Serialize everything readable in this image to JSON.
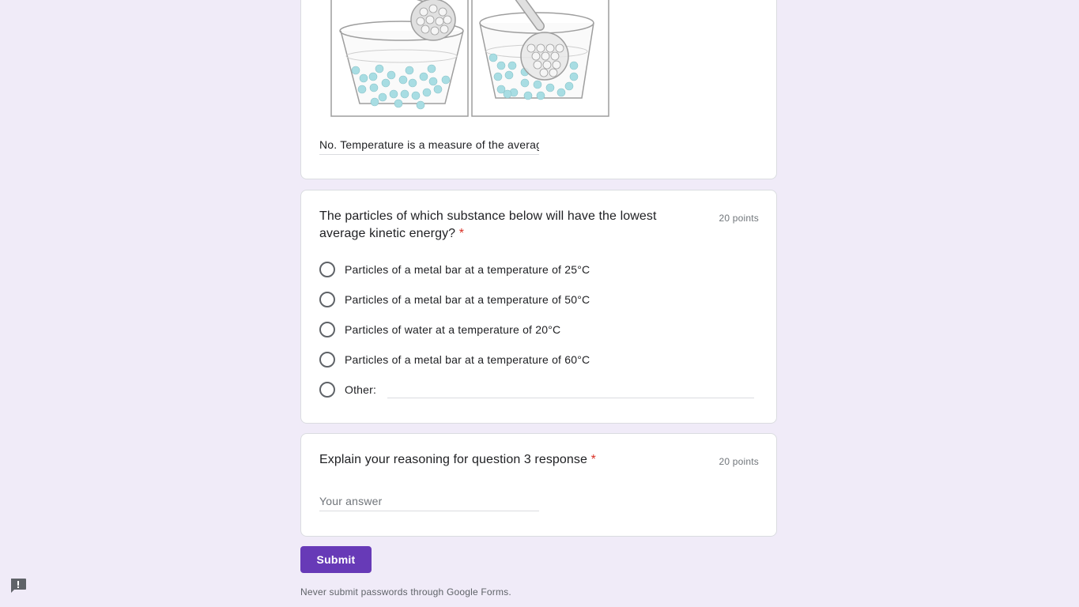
{
  "question2": {
    "answer_value": "No. Temperature is a measure of the average k"
  },
  "question3": {
    "title": "The particles of which substance below will have the lowest average kinetic energy?",
    "required_mark": "*",
    "points": "20 points",
    "options": [
      {
        "label": "Particles of a metal bar at a temperature of 25°C"
      },
      {
        "label": "Particles of a metal bar at a temperature of 50°C"
      },
      {
        "label": "Particles of water at a temperature of 20°C"
      },
      {
        "label": "Particles of a metal bar at a temperature of 60°C"
      },
      {
        "label": "Other:"
      }
    ]
  },
  "question4": {
    "title": "Explain your reasoning for question 3 response",
    "required_mark": "*",
    "points": "20 points",
    "placeholder": "Your answer"
  },
  "submit_label": "Submit",
  "footer_note": "Never submit passwords through Google Forms.",
  "icons": {
    "feedback": "report-feedback-icon",
    "radio": "radio-unchecked-icon"
  },
  "colors": {
    "background": "#f0ebf8",
    "accent": "#673ab7",
    "required": "#d93025",
    "particle": "#a8dde3"
  }
}
